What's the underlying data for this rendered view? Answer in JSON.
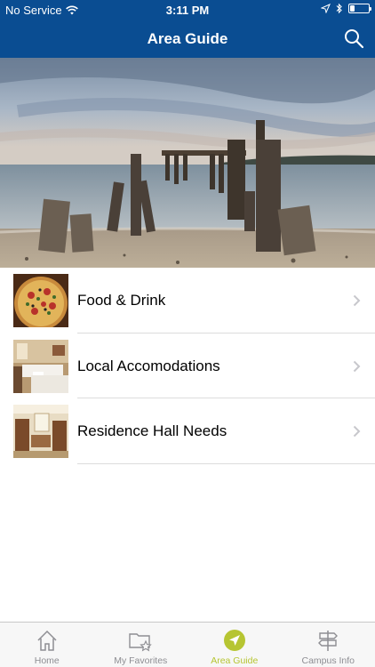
{
  "status": {
    "carrier": "No Service",
    "time": "3:11 PM"
  },
  "header": {
    "title": "Area Guide"
  },
  "list": {
    "items": [
      {
        "label": "Food & Drink",
        "thumb": "pizza-photo"
      },
      {
        "label": "Local Accomodations",
        "thumb": "hotel-room-photo"
      },
      {
        "label": "Residence Hall Needs",
        "thumb": "dorm-room-photo"
      }
    ]
  },
  "tabs": [
    {
      "label": "Home",
      "icon": "home-icon"
    },
    {
      "label": "My Favorites",
      "icon": "favorites-folder-icon"
    },
    {
      "label": "Area Guide",
      "icon": "navigation-arrow-icon",
      "active": true
    },
    {
      "label": "Campus Info",
      "icon": "signpost-icon"
    }
  ],
  "colors": {
    "nav_bar": "#0a4d92",
    "active_tab": "#b6c532",
    "inactive_tab": "#8e8e93"
  }
}
